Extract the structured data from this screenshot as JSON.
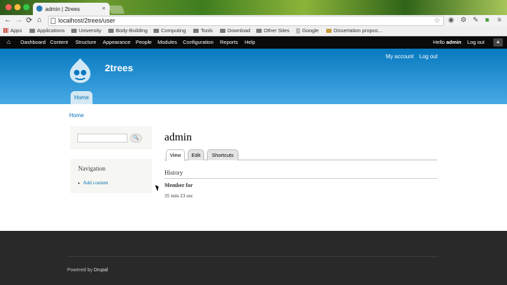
{
  "window": {
    "tab_title": "admin | 2trees",
    "tab_close": "×",
    "url": "localhost/2trees/user"
  },
  "browser": {
    "nav_back": "←",
    "nav_forward": "→",
    "reload": "⟳",
    "home": "⌂",
    "star": "☆"
  },
  "bookmarks": [
    {
      "label": "Apps"
    },
    {
      "label": "Applications"
    },
    {
      "label": "University"
    },
    {
      "label": "Body-Building"
    },
    {
      "label": "Computing"
    },
    {
      "label": "Tools"
    },
    {
      "label": "Download"
    },
    {
      "label": "Other Sites"
    },
    {
      "label": "Google"
    },
    {
      "label": "Dissertation propos…"
    }
  ],
  "admin_toolbar": {
    "items": [
      "Dashboard",
      "Content",
      "Structure",
      "Appearance",
      "People",
      "Modules",
      "Configuration",
      "Reports",
      "Help"
    ],
    "hello_prefix": "Hello ",
    "user": "admin",
    "logout": "Log out"
  },
  "header": {
    "site_name": "2trees",
    "my_account": "My account",
    "log_out": "Log out",
    "main_tab": "Home"
  },
  "content": {
    "breadcrumb": "Home",
    "search_button": "🔍",
    "navigation_title": "Navigation",
    "nav_link": "Add content",
    "page_title": "admin",
    "tabs": [
      "View",
      "Edit",
      "Shortcuts"
    ],
    "history": "History",
    "member_label": "Member for",
    "member_value": "35 min 23 sec"
  },
  "footer": {
    "powered_prefix": "Powered by ",
    "powered_link": "Drupal"
  },
  "colors": {
    "header_blue": "#0779bf",
    "link_blue": "#0071b3",
    "footer": "#292929"
  }
}
